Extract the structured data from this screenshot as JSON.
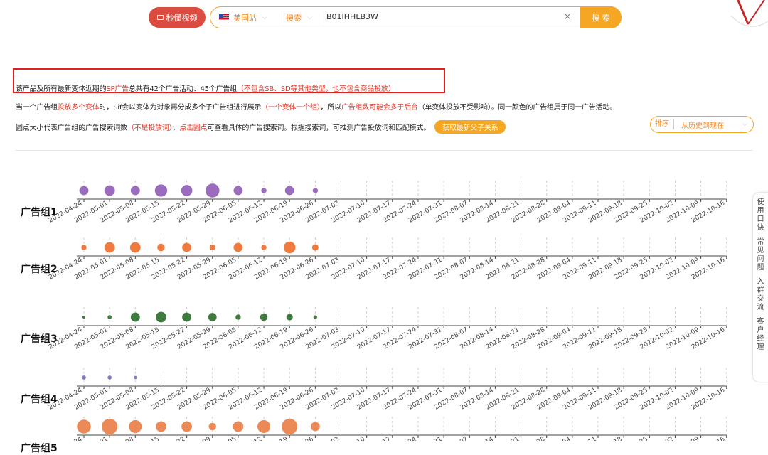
{
  "toolbar": {
    "demo_label": "秒懂视频",
    "site": "美国站",
    "mode": "搜索",
    "asin": "B01IHHLB3W",
    "clear": "×",
    "search_button": "搜 索"
  },
  "info": {
    "line1_a": "该产品及所有最新变体近期的",
    "line1_b": "SP广告",
    "line1_c": "总共有42个广告活动、45个广告组",
    "line1_d": "（不包含SB、SD等其他类型，也不包含商品投放）",
    "line2_a": "当一个广告组",
    "line2_b": "投放多个变体",
    "line2_c": "时，Sif会以变体为对象再分成多个子广告组进行展示",
    "line2_d": "（一个变体一个组）",
    "line2_e": "，所以",
    "line2_f": "广告组数可能会多于后台",
    "line2_g": "（单变体投放不受影响）。同一颜色的广告组属于同一广告活动。",
    "line3_a": "圆点大小代表广告组的广告搜索词数",
    "line3_b": "（不是投放词）",
    "line3_c": "，",
    "line3_d": "点击圆点",
    "line3_e": "可查看具体的广告搜索词。根据搜索词，可推测广告投放词和匹配模式。",
    "get_button": "获取最新父子关系"
  },
  "sort": {
    "label": "排序",
    "value": "从历史到现在"
  },
  "sidebar": [
    "使用口诀",
    "常见问题",
    "入群交流",
    "客户经理"
  ],
  "chart_data": {
    "type": "scatter",
    "dates": [
      "2022-04-24",
      "2022-05-01",
      "2022-05-08",
      "2022-05-15",
      "2022-05-22",
      "2022-05-29",
      "2022-06-05",
      "2022-06-12",
      "2022-06-19",
      "2022-06-26",
      "2022-07-03",
      "2022-07-10",
      "2022-07-17",
      "2022-07-24",
      "2022-07-31",
      "2022-08-07",
      "2022-08-14",
      "2022-08-21",
      "2022-08-28",
      "2022-09-04",
      "2022-09-11",
      "2022-09-18",
      "2022-09-25",
      "2022-10-02",
      "2022-10-09",
      "2022-10-16"
    ],
    "groups": [
      {
        "name": "广告组1",
        "color": "#9b6bbd",
        "sizes": [
          3,
          4,
          3,
          5.5,
          4.5,
          7,
          3,
          1,
          3,
          1
        ]
      },
      {
        "name": "广告组2",
        "color": "#f07b3f",
        "sizes": [
          1,
          4,
          4,
          2,
          3,
          1.2,
          3,
          1,
          5,
          1.5
        ]
      },
      {
        "name": "广告组3",
        "color": "#3f7a3f",
        "sizes": [
          0.3,
          0.6,
          3,
          4,
          3,
          2.5,
          1,
          2,
          1.5,
          0.5
        ]
      },
      {
        "name": "广告组4",
        "color": "#8c7ac0",
        "sizes": [
          0.6,
          0.6,
          0.4,
          0,
          0,
          0,
          0,
          0,
          0,
          0
        ]
      },
      {
        "name": "广告组5",
        "color": "#eb8a57",
        "sizes": [
          7,
          9,
          6,
          4,
          4,
          2,
          4,
          6,
          9,
          3
        ]
      }
    ]
  }
}
